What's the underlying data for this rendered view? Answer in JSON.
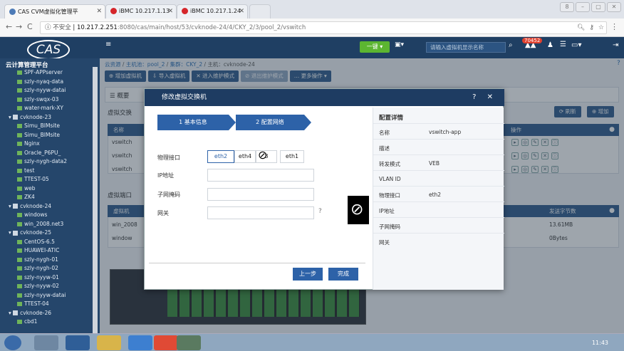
{
  "browser": {
    "tabs": [
      {
        "label": "CAS CVM虚拟化管理平"
      },
      {
        "label": "iBMC 10.217.1.13"
      },
      {
        "label": "iBMC 10.217.1.24"
      }
    ],
    "nav": {
      "back": "←",
      "forward": "→",
      "reload": "C"
    },
    "url": {
      "security": "不安全",
      "host": "10.217.2.251",
      "path": ":8080/cas/main/host/53/cvknode-24/4/CKY_2/3/pool_2/vswitch"
    },
    "window_controls": [
      "8",
      "–",
      "▢",
      "✕"
    ]
  },
  "app": {
    "logo": "CAS",
    "title": "云计算管理平台",
    "top": {
      "one_key": "一键",
      "search_placeholder": "请输入虚拟机显示名称",
      "alert_count": "70452"
    }
  },
  "sidebar": {
    "items": [
      {
        "label": "SPF-APPserver",
        "type": "vm"
      },
      {
        "label": "szly-nyaq-data",
        "type": "vm"
      },
      {
        "label": "szly-nyyw-datai",
        "type": "vm"
      },
      {
        "label": "szly-swqx-03",
        "type": "vm"
      },
      {
        "label": "water-mark-XY",
        "type": "vm"
      },
      {
        "label": "cvknode-23",
        "type": "host"
      },
      {
        "label": "Simu_BIMsite",
        "type": "vm"
      },
      {
        "label": "Simu_BIMsite",
        "type": "vm"
      },
      {
        "label": "Nginx",
        "type": "vm"
      },
      {
        "label": "Oracle_P6PU_",
        "type": "vm"
      },
      {
        "label": "szly-nygh-data2",
        "type": "vm"
      },
      {
        "label": "test",
        "type": "vm"
      },
      {
        "label": "TTEST-05",
        "type": "vm"
      },
      {
        "label": "web",
        "type": "vm"
      },
      {
        "label": "ZK4",
        "type": "vm"
      },
      {
        "label": "cvknode-24",
        "type": "host"
      },
      {
        "label": "windows",
        "type": "vm"
      },
      {
        "label": "win_2008.net3",
        "type": "vm"
      },
      {
        "label": "cvknode-25",
        "type": "host"
      },
      {
        "label": "CentOS-6.5",
        "type": "vm"
      },
      {
        "label": "HUAWEI-ATIC",
        "type": "vm"
      },
      {
        "label": "szly-nygh-01",
        "type": "vm"
      },
      {
        "label": "szly-nygh-02",
        "type": "vm"
      },
      {
        "label": "szly-nyyw-01",
        "type": "vm"
      },
      {
        "label": "szly-nyyw-02",
        "type": "vm"
      },
      {
        "label": "szly-nyyw-datai",
        "type": "vm"
      },
      {
        "label": "TTEST-04",
        "type": "vm"
      },
      {
        "label": "cvknode-26",
        "type": "host"
      },
      {
        "label": "cbd1",
        "type": "vm"
      }
    ]
  },
  "main": {
    "breadcrumb": {
      "root": "云资源",
      "pool_label": "主机池：pool_2",
      "cluster_label": "集群：CKY_2",
      "host_label": "主机：cvknode-24"
    },
    "actions": [
      "增加虚拟机",
      "导入虚拟机",
      "进入维护模式",
      "退出维护模式",
      "更多操作"
    ],
    "summary_tab": "概要",
    "vswitch_section": "虚拟交换",
    "vswitch_header": [
      "名称"
    ],
    "vswitch_rows": [
      "vswitch",
      "vswitch",
      "vswitch"
    ],
    "ops_header": "操作",
    "refresh_label": "刷新",
    "add_label": "增加",
    "port_section": "虚拟端口",
    "port_header_left": "虚拟机",
    "port_header_right": "发送字节数",
    "port_rows": [
      {
        "name": "win_2008",
        "bytes": "13.61MB"
      },
      {
        "name": "window",
        "bytes": "0Bytes"
      }
    ]
  },
  "modal": {
    "title": "修改虚拟交换机",
    "controls": "? ✕",
    "step1": "1 基本信息",
    "step2": "2 配置网络",
    "form": {
      "iface_label": "物理接口",
      "ip_label": "IP地址",
      "mask_label": "子网掩码",
      "gw_label": "网关",
      "nics": [
        "eth2",
        "eth4",
        "3",
        "eth1"
      ]
    },
    "prev_button": "上一步",
    "finish_button": "完成",
    "detail": {
      "title": "配置详情",
      "rows": [
        {
          "k": "名称",
          "v": "vswitch-app"
        },
        {
          "k": "描述",
          "v": ""
        },
        {
          "k": "转发模式",
          "v": "VEB"
        },
        {
          "k": "VLAN ID",
          "v": ""
        },
        {
          "k": "物理接口",
          "v": "eth2"
        },
        {
          "k": "IP地址",
          "v": ""
        },
        {
          "k": "子网掩码",
          "v": ""
        },
        {
          "k": "网关",
          "v": ""
        }
      ]
    }
  },
  "taskbar": {
    "clock": "11:43"
  }
}
